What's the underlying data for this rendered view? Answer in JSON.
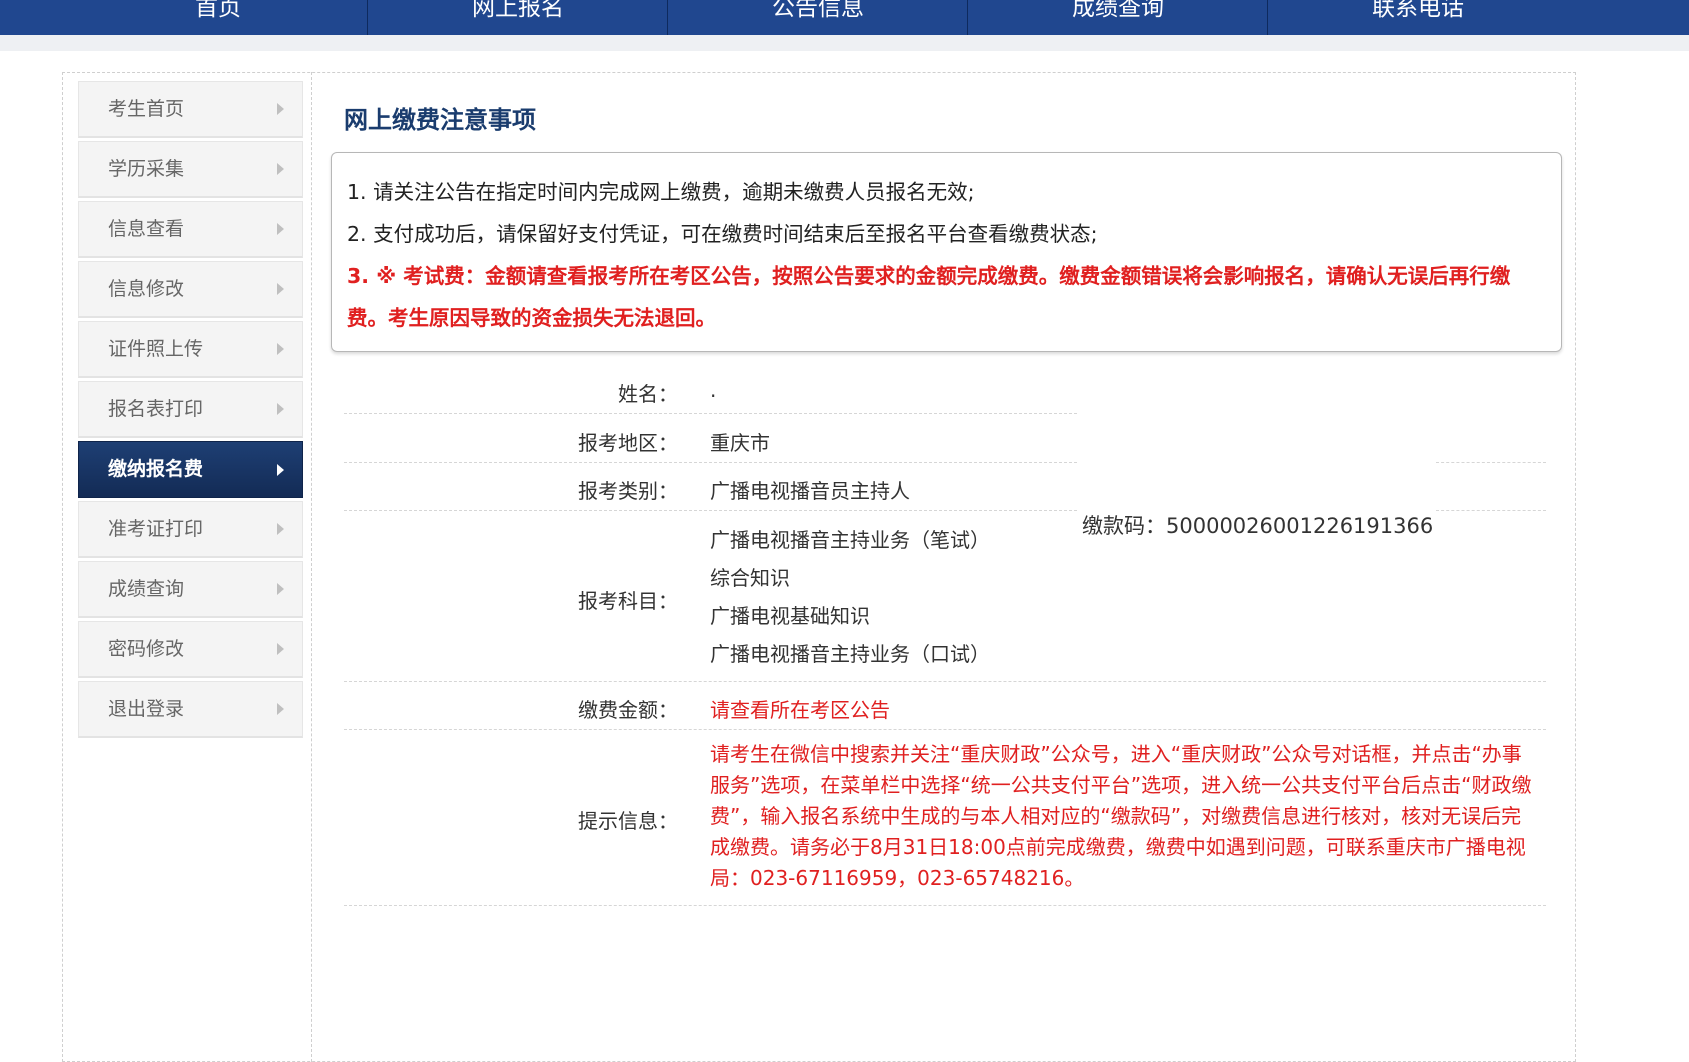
{
  "nav": {
    "items": [
      "首页",
      "网上报名",
      "公告信息",
      "成绩查询",
      "联系电话"
    ]
  },
  "sidebar": {
    "items": [
      {
        "label": "考生首页"
      },
      {
        "label": "学历采集"
      },
      {
        "label": "信息查看"
      },
      {
        "label": "信息修改"
      },
      {
        "label": "证件照上传"
      },
      {
        "label": "报名表打印"
      },
      {
        "label": "缴纳报名费",
        "active": true
      },
      {
        "label": "准考证打印"
      },
      {
        "label": "成绩查询"
      },
      {
        "label": "密码修改"
      },
      {
        "label": "退出登录"
      }
    ]
  },
  "main": {
    "title": "网上缴费注意事项",
    "notice": [
      "1. 请关注公告在指定时间内完成网上缴费，逾期未缴费人员报名无效;",
      "2. 支付成功后，请保留好支付凭证，可在缴费时间结束后至报名平台查看缴费状态;",
      "3. ※ 考试费：金额请查看报考所在考区公告，按照公告要求的金额完成缴费。缴费金额错误将会影响报名，请确认无误后再行缴费。考生原因导致的资金损失无法退回。"
    ],
    "info": {
      "name_label": "姓名：",
      "name_value": ".",
      "region_label": "报考地区：",
      "region_value": "重庆市",
      "category_label": "报考类别：",
      "category_value": "广播电视播音员主持人",
      "subjects_label": "报考科目：",
      "subjects": [
        "广播电视播音主持业务（笔试）",
        "综合知识",
        "广播电视基础知识",
        "广播电视播音主持业务（口试）"
      ],
      "fee_label": "缴费金额：",
      "fee_value": "请查看所在考区公告",
      "tip_label": "提示信息：",
      "tip_value": "请考生在微信中搜索并关注“重庆财政”公众号，进入“重庆财政”公众号对话框，并点击“办事服务”选项，在菜单栏中选择“统一公共支付平台”选项，进入统一公共支付平台后点击“财政缴费”，输入报名系统中生成的与本人相对应的“缴款码”，对缴费信息进行核对，核对无误后完成缴费。请务必于8月31日18:00点前完成缴费，缴费中如遇到问题，可联系重庆市广播电视局：023-67116959，023-65748216。",
      "paycode_label": "缴款码：",
      "paycode_value": "50000026001226191366"
    }
  }
}
